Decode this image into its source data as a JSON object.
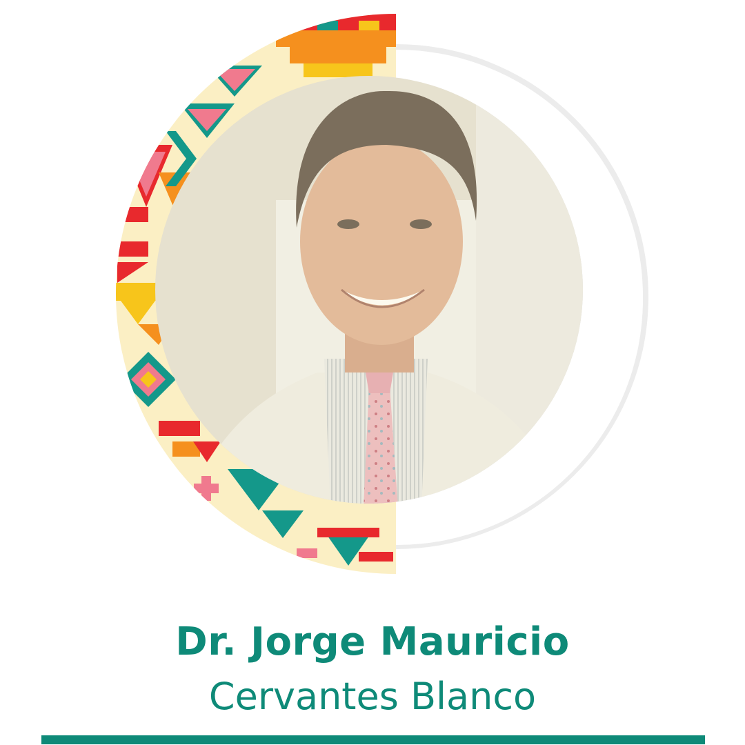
{
  "profile": {
    "name_line1": "Dr. Jorge Mauricio",
    "name_line2": "Cervantes Blanco",
    "photo_subject": "portrait of a smiling man in a white lab coat, striped shirt and pink tie"
  },
  "colors": {
    "brand_teal": "#0e8a78",
    "pattern_cream": "#fbefc4",
    "pattern_orange": "#f5901e",
    "pattern_red": "#e8292d",
    "pattern_pink": "#f07a8e",
    "pattern_yellow": "#f7c51b",
    "pattern_teal": "#14988a",
    "photo_tint": "#f6efcd",
    "photo_wall": "#dedad0",
    "coat_white": "#ecebe6",
    "hair_dark": "#3a2a20",
    "skin": "#d9a07e",
    "tie_pink": "#e9a7b6",
    "shirt_stripe": "#c9ced2"
  },
  "icons": {
    "pattern": "aztec-pixel-pattern-icon"
  }
}
